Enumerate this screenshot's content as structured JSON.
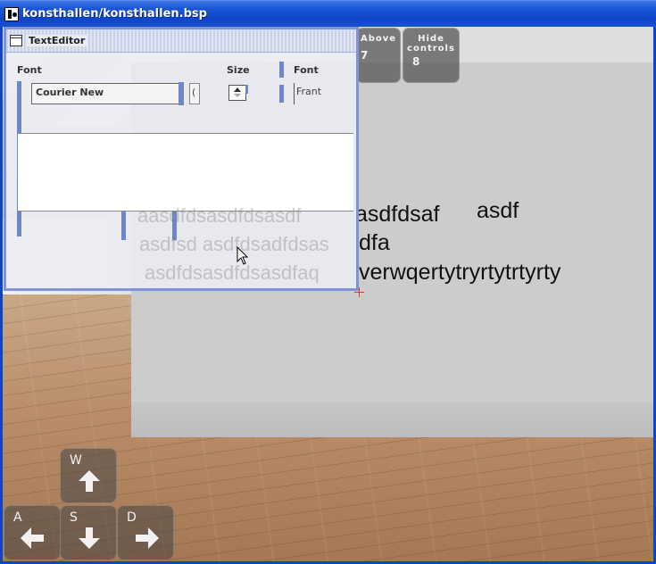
{
  "window": {
    "title": "konsthallen/konsthallen.bsp"
  },
  "scene": {
    "wall_lines": [
      "asdfdsaf",
      "asdf",
      "dfa",
      "verwqertytryrtytrtyrty"
    ],
    "ghost_lines": [
      "aasdfdsasdfdsasdf",
      "asdfsd asdfdsadfdsas",
      "asdfdsasdfdsasdfaq"
    ]
  },
  "hud": {
    "above": {
      "label": "Above",
      "key": "7"
    },
    "hide_controls": {
      "label": "Hide controls",
      "key": "8"
    }
  },
  "controls": {
    "w": "W",
    "a": "A",
    "s": "S",
    "d": "D"
  },
  "editor": {
    "title": "TextEditor",
    "font_label": "Font",
    "size_label": "Size",
    "font2_label": "Font",
    "font_value": "Courier New",
    "size_field_value": "(",
    "font2_value": "Frant"
  },
  "colors": {
    "titlebar": "#0d45c9",
    "crosshair": "#ff2a2a",
    "editor_border": "#7e95d2"
  }
}
